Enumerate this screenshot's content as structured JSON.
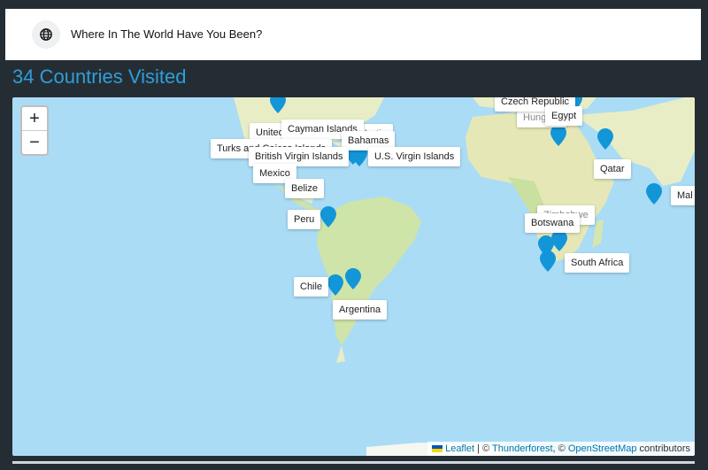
{
  "header": {
    "title": "Where In The World Have You Been?",
    "icon": "globe-icon"
  },
  "heading": "34 Countries Visited",
  "map": {
    "zoom_in": "+",
    "zoom_out": "−",
    "marker_color": "#1296d8",
    "labels": [
      "United",
      "Cayman Islands",
      "Martin",
      "Bahamas",
      "Turks and Caicos Islands",
      "British Virgin Islands",
      "U.S. Virgin Islands",
      "Mexico",
      "Belize",
      "Peru",
      "Chile",
      "Argentina",
      "Czech Republic",
      "Hungary",
      "Egypt",
      "Qatar",
      "Mal",
      "Zimbabwe",
      "Botswana",
      "South Africa"
    ],
    "attribution": {
      "leaflet": "Leaflet",
      "sep1": " | © ",
      "thunderforest": "Thunderforest",
      "sep2": ", © ",
      "osm": "OpenStreetMap",
      "suffix": " contributors"
    }
  }
}
